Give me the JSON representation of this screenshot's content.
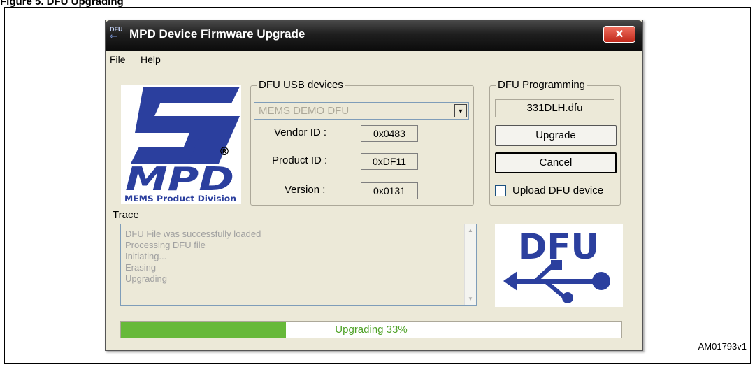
{
  "figure": {
    "caption": "Figure 5.    DFU Upgrading",
    "id": "AM01793v1"
  },
  "window": {
    "title": "MPD Device Firmware Upgrade",
    "icon_text": "DFU",
    "close_label": "✕"
  },
  "menu": {
    "items": [
      "File",
      "Help"
    ]
  },
  "logos": {
    "st": {
      "brand": "ST",
      "product": "MPD",
      "tagline": "MEMS Product Division",
      "registered": "®",
      "color": "#2b3f9e"
    },
    "dfu": {
      "text": "DFU",
      "color": "#2b3f9e"
    }
  },
  "devices": {
    "legend": "DFU USB devices",
    "selected": "MEMS DEMO DFU",
    "vendor_label": "Vendor ID :",
    "vendor_value": "0x0483",
    "product_label": "Product ID :",
    "product_value": "0xDF11",
    "version_label": "Version :",
    "version_value": "0x0131"
  },
  "programming": {
    "legend": "DFU Programming",
    "file": "331DLH.dfu",
    "upgrade_label": "Upgrade",
    "cancel_label": "Cancel",
    "upload_label": "Upload DFU device",
    "upload_checked": false
  },
  "trace": {
    "label": "Trace",
    "lines": [
      "DFU File was successfully loaded",
      "Processing DFU file",
      "Initiating...",
      "Erasing",
      "Upgrading"
    ]
  },
  "progress": {
    "percent": 33,
    "text": "Upgrading 33%",
    "fill_color": "#67b93a"
  }
}
